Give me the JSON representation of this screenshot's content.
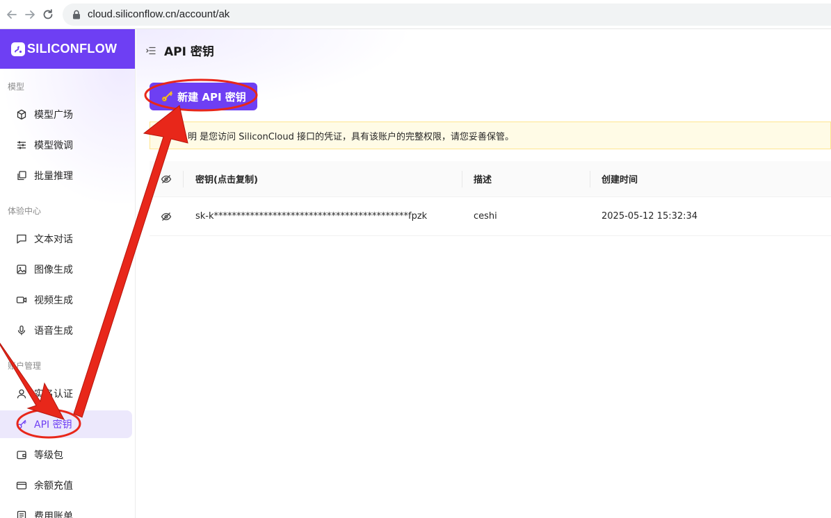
{
  "browser": {
    "url": "cloud.siliconflow.cn/account/ak"
  },
  "sidebar": {
    "brand": "SILICONFLOW",
    "groups": [
      {
        "label": "模型"
      },
      {
        "label": "体验中心"
      },
      {
        "label": "账户管理"
      }
    ],
    "items": [
      {
        "label": "模型广场",
        "icon": "cube-icon"
      },
      {
        "label": "模型微调",
        "icon": "sliders-icon"
      },
      {
        "label": "批量推理",
        "icon": "copy-icon"
      },
      {
        "label": "文本对话",
        "icon": "chat-icon"
      },
      {
        "label": "图像生成",
        "icon": "image-icon"
      },
      {
        "label": "视频生成",
        "icon": "video-icon"
      },
      {
        "label": "语音生成",
        "icon": "mic-icon"
      },
      {
        "label": "实名认证",
        "icon": "id-icon"
      },
      {
        "label": "API 密钥",
        "icon": "key-icon",
        "active": true
      },
      {
        "label": "等级包",
        "icon": "wallet-icon"
      },
      {
        "label": "余额充值",
        "icon": "card-icon"
      },
      {
        "label": "费用账单",
        "icon": "bill-icon"
      }
    ]
  },
  "main": {
    "title": "API 密钥",
    "create_button": "新建 API 密钥",
    "notice": "明 是您访问 SiliconCloud 接口的凭证，具有该账户的完整权限，请您妥善保管。",
    "table": {
      "headers": {
        "key": "密钥(点击复制)",
        "desc": "描述",
        "created": "创建时间"
      },
      "rows": [
        {
          "key": "sk-k*******************************************fpzk",
          "desc": "ceshi",
          "created": "2025-05-12 15:32:34"
        }
      ]
    }
  },
  "colors": {
    "brand": "#6e3ff3",
    "annotation": "#e8271a"
  }
}
